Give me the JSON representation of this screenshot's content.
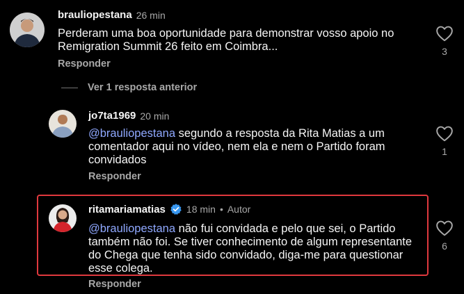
{
  "comments": [
    {
      "username": "brauliopestana",
      "time": "26 min",
      "text": "Perderam uma boa oportunidade para demonstrar vosso apoio no Remigration Summit 26 feito em Coimbra...",
      "reply_label": "Responder",
      "like_count": "3",
      "like_icon": "heart-outline-icon"
    },
    {
      "username": "jo7ta1969",
      "time": "20 min",
      "mention": "@brauliopestana",
      "text": " segundo a resposta da Rita Matias a um comentador aqui no vídeo, nem ela e nem o Partido foram convidados",
      "reply_label": "Responder",
      "like_count": "1",
      "like_icon": "heart-outline-icon"
    },
    {
      "username": "ritamariamatias",
      "verified": true,
      "time": "18 min",
      "separator": "•",
      "author_label": "Autor",
      "mention": "@brauliopestana",
      "text": " não fui convidada e pelo que sei, o Partido também não foi. Se tiver conhecimento de algum representante do Chega que tenha sido convidado, diga-me para questionar esse colega.",
      "reply_label": "Responder",
      "like_count": "6",
      "like_icon": "heart-outline-icon"
    }
  ],
  "view_previous": "Ver 1 resposta anterior",
  "colors": {
    "background": "#000000",
    "mention": "#8fa8ff",
    "highlight_border": "#e0393e",
    "verified": "#3897f0"
  }
}
